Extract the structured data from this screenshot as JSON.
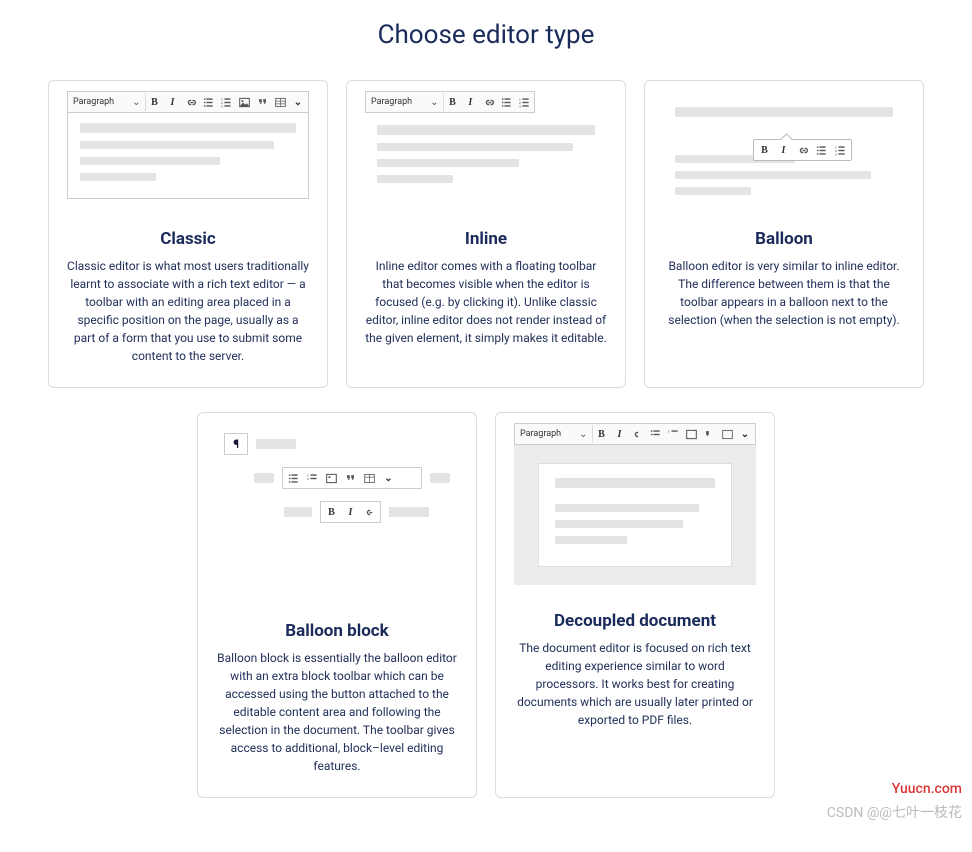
{
  "page_title": "Choose editor type",
  "toolbar": {
    "paragraph_label": "Paragraph",
    "bold": "B",
    "italic": "I",
    "pilcrow": "¶"
  },
  "cards": {
    "classic": {
      "title": "Classic",
      "desc": "Classic editor is what most users traditionally learnt to associate with a rich text editor — a toolbar with an editing area placed in a specific position on the page, usually as a part of a form that you use to submit some content to the server."
    },
    "inline": {
      "title": "Inline",
      "desc": "Inline editor comes with a floating toolbar that becomes visible when the editor is focused (e.g. by clicking it). Unlike classic editor, inline editor does not render instead of the given element, it simply makes it editable."
    },
    "balloon": {
      "title": "Balloon",
      "desc": "Balloon editor is very similar to inline editor. The difference between them is that the toolbar appears in a balloon next to the selection (when the selection is not empty)."
    },
    "balloon_block": {
      "title": "Balloon block",
      "desc": "Balloon block is essentially the balloon editor with an extra block toolbar which can be accessed using the button attached to the editable content area and following the selection in the document. The toolbar gives access to additional, block–level editing features."
    },
    "decoupled": {
      "title": "Decoupled document",
      "desc": "The document editor is focused on rich text editing experience similar to word processors. It works best for creating documents which are usually later printed or exported to PDF files."
    }
  },
  "watermark_red": "Yuucn.com",
  "watermark_grey": "CSDN @@七叶一枝花"
}
